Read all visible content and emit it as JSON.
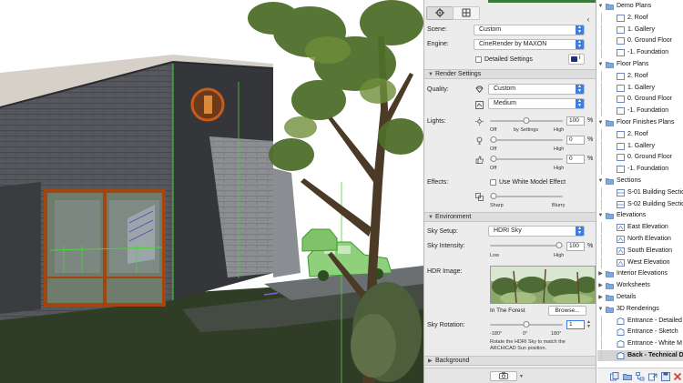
{
  "toolbar": {
    "tabs": [
      {
        "name": "settings-tab",
        "icon": "gear-icon",
        "active": true
      },
      {
        "name": "layout-tab",
        "icon": "grid-icon",
        "active": false
      }
    ],
    "nav_glyph": "‹"
  },
  "top_settings": {
    "scene_label": "Scene:",
    "scene_value": "Custom",
    "engine_label": "Engine:",
    "engine_value": "CineRender by MAXON",
    "detailed_settings_label": "Detailed Settings",
    "info_glyph": "i"
  },
  "render_settings": {
    "header": "Render Settings",
    "quality_label": "Quality:",
    "quality_preset": "Custom",
    "quality_level": "Medium",
    "lights_label": "Lights:",
    "lights": [
      {
        "icon": "sun-icon",
        "value": "100",
        "unit": "%",
        "fraction": 0.5,
        "ticks": [
          "Off",
          "by Settings",
          "High"
        ]
      },
      {
        "icon": "light-bulb-icon",
        "value": "0",
        "unit": "%",
        "fraction": 0.0,
        "ticks": [
          "Off",
          "High"
        ]
      },
      {
        "icon": "thumbs-up-icon",
        "value": "0",
        "unit": "%",
        "fraction": 0.0,
        "ticks": [
          "Off",
          "High"
        ]
      }
    ],
    "effects_label": "Effects:",
    "white_model_label": "Use White Model Effect",
    "sharpness_fraction": 0.0,
    "sharpness_ticks": [
      "Sharp",
      "Blurry"
    ]
  },
  "environment": {
    "header": "Environment",
    "sky_setup_label": "Sky Setup:",
    "sky_setup_value": "HDRI Sky",
    "sky_intensity_label": "Sky Intensity:",
    "sky_intensity_value": "100",
    "sky_intensity_unit": "%",
    "sky_intensity_fraction": 1.0,
    "sky_intensity_ticks": [
      "Low",
      "High"
    ],
    "hdr_image_label": "HDR Image:",
    "hdr_name": "In The Forest",
    "browse_label": "Browse...",
    "sky_rotation_label": "Sky Rotation:",
    "sky_rotation_value": "1",
    "sky_rotation_fraction": 0.5,
    "sky_rotation_ticks": [
      "-180°",
      "0°",
      "180°"
    ],
    "hint_line1": "Rotate the HDRI Sky to match the",
    "hint_line2": "ARCHICAD Sun position."
  },
  "background": {
    "header": "Background"
  },
  "camera_button": {
    "icon": "camera-icon"
  },
  "navigator": {
    "items": [
      {
        "label": "Demo Plans",
        "level": 0,
        "kind": "folder",
        "expanded": true
      },
      {
        "label": "2. Roof",
        "level": 1,
        "kind": "plan"
      },
      {
        "label": "1. Gallery",
        "level": 1,
        "kind": "plan"
      },
      {
        "label": "0. Ground Floor",
        "level": 1,
        "kind": "plan"
      },
      {
        "label": "-1. Foundation",
        "level": 1,
        "kind": "plan"
      },
      {
        "label": "Floor Plans",
        "level": 0,
        "kind": "folder",
        "expanded": true
      },
      {
        "label": "2. Roof",
        "level": 1,
        "kind": "plan"
      },
      {
        "label": "1. Gallery",
        "level": 1,
        "kind": "plan"
      },
      {
        "label": "0. Ground Floor",
        "level": 1,
        "kind": "plan"
      },
      {
        "label": "-1. Foundation",
        "level": 1,
        "kind": "plan"
      },
      {
        "label": "Floor Finishes Plans",
        "level": 0,
        "kind": "folder",
        "expanded": true
      },
      {
        "label": "2. Roof",
        "level": 1,
        "kind": "plan"
      },
      {
        "label": "1. Gallery",
        "level": 1,
        "kind": "plan"
      },
      {
        "label": "0. Ground Floor",
        "level": 1,
        "kind": "plan"
      },
      {
        "label": "-1. Foundation",
        "level": 1,
        "kind": "plan"
      },
      {
        "label": "Sections",
        "level": 0,
        "kind": "folder",
        "expanded": true
      },
      {
        "label": "S-01 Building Section",
        "level": 1,
        "kind": "section"
      },
      {
        "label": "S-02 Building Section",
        "level": 1,
        "kind": "section"
      },
      {
        "label": "Elevations",
        "level": 0,
        "kind": "folder",
        "expanded": true
      },
      {
        "label": "East Elevation",
        "level": 1,
        "kind": "elevation"
      },
      {
        "label": "North Elevation",
        "level": 1,
        "kind": "elevation"
      },
      {
        "label": "South Elevation",
        "level": 1,
        "kind": "elevation"
      },
      {
        "label": "West Elevation",
        "level": 1,
        "kind": "elevation"
      },
      {
        "label": "Interior Elevations",
        "level": 0,
        "kind": "folder",
        "expanded": false
      },
      {
        "label": "Worksheets",
        "level": 0,
        "kind": "folder",
        "expanded": false
      },
      {
        "label": "Details",
        "level": 0,
        "kind": "folder",
        "expanded": false
      },
      {
        "label": "3D Renderings",
        "level": 0,
        "kind": "folder",
        "expanded": true
      },
      {
        "label": "Entrance - Detailed",
        "level": 1,
        "kind": "render"
      },
      {
        "label": "Entrance - Sketch",
        "level": 1,
        "kind": "render"
      },
      {
        "label": "Entrance - White M",
        "level": 1,
        "kind": "render"
      },
      {
        "label": "Back - Technical D",
        "level": 1,
        "kind": "render",
        "selected": true
      }
    ],
    "bottom_buttons": [
      {
        "name": "new-viewpoint-button",
        "icon": "new-view-icon"
      },
      {
        "name": "clone-folder-button",
        "icon": "folder-icon"
      },
      {
        "name": "tree-options-button",
        "icon": "tree-icon"
      },
      {
        "name": "move-button",
        "icon": "move-icon"
      },
      {
        "name": "save-view-button",
        "icon": "save-view-icon"
      },
      {
        "name": "delete-button",
        "icon": "delete-icon"
      }
    ]
  },
  "colors": {
    "accent_blue": "#3d7ddc",
    "panel_bg": "#ececec",
    "brick_dark": "#4b4d52",
    "window_frame": "#b04a12",
    "selection_green": "#4cd43a",
    "delete_red": "#d23b2e"
  }
}
